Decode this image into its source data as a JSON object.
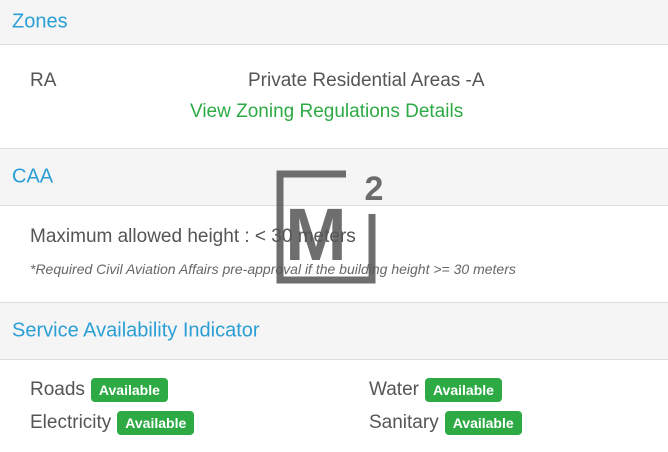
{
  "zones": {
    "heading": "Zones",
    "code": "RA",
    "description": "Private Residential Areas -A",
    "link_label": "View Zoning Regulations Details"
  },
  "caa": {
    "heading": "CAA",
    "max_height": "Maximum allowed height : < 30 meters",
    "note": "*Required Civil Aviation Affairs pre-approval if the building height >= 30 meters"
  },
  "services": {
    "heading": "Service Availability Indicator",
    "items": [
      {
        "label": "Roads",
        "status": "Available"
      },
      {
        "label": "Water",
        "status": "Available"
      },
      {
        "label": "Electricity",
        "status": "Available"
      },
      {
        "label": "Sanitary",
        "status": "Available"
      }
    ],
    "status_color": "#2eaa45"
  },
  "watermark": {
    "text": "M",
    "superscript": "2",
    "color": "#555555"
  },
  "colors": {
    "heading": "#2a9fd6",
    "link": "#2eaa45",
    "header_bg": "#f5f5f5"
  }
}
